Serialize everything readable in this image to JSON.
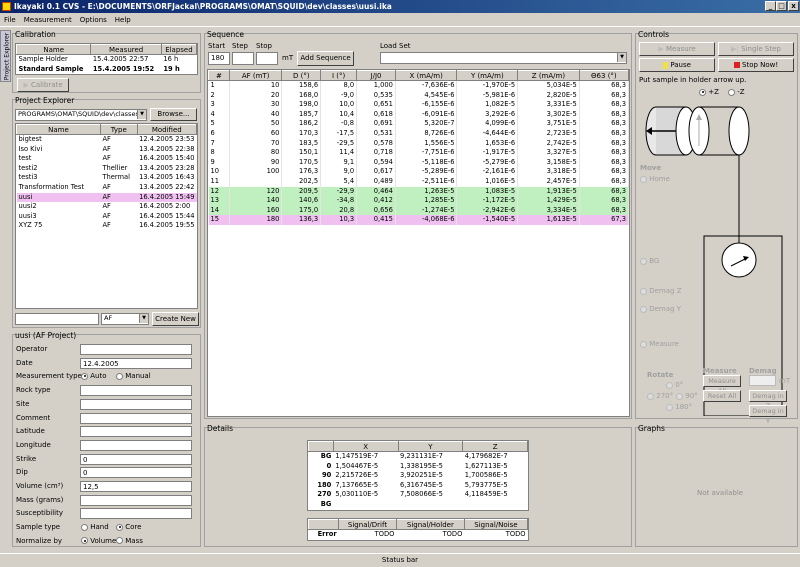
{
  "window": {
    "title": "Ikayaki 0.1 CVS - E:\\DOCUMENTS\\ORFJackal\\PROGRAMS\\OMAT\\SQUID\\dev\\classes\\uusi.ika",
    "min": "_",
    "max": "□",
    "close": "x"
  },
  "menu": [
    "File",
    "Measurement",
    "Options",
    "Help"
  ],
  "side_tab": "Project Explorer",
  "calibration": {
    "title": "Calibration",
    "headers": [
      "Name",
      "Measured",
      "Elapsed"
    ],
    "rows": [
      [
        "Sample Holder",
        "15.4.2005 22:57",
        "16 h"
      ],
      [
        "Standard Sample",
        "15.4.2005 19:52",
        "19 h"
      ]
    ],
    "button": "Calibrate"
  },
  "explorer": {
    "title": "Project Explorer",
    "path": "PROGRAMS\\OMAT\\SQUID\\dev\\classes",
    "browse": "Browse...",
    "headers": [
      "Name",
      "Type",
      "Modified"
    ],
    "rows": [
      [
        "bigtest",
        "AF",
        "12.4.2005 23:53"
      ],
      [
        "Iso Kivi",
        "AF",
        "13.4.2005 22:38"
      ],
      [
        "test",
        "AF",
        "16.4.2005 15:40"
      ],
      [
        "testi2",
        "Thellier",
        "13.4.2005 23:28"
      ],
      [
        "testi3",
        "Thermal",
        "13.4.2005 16:43"
      ],
      [
        "Transformation Test",
        "AF",
        "13.4.2005 22:42"
      ],
      [
        "uusi",
        "AF",
        "16.4.2005 15:49"
      ],
      [
        "uusi2",
        "AF",
        "16.4.2005 2:00"
      ],
      [
        "uusi3",
        "AF",
        "16.4.2005 15:44"
      ],
      [
        "XYZ 75",
        "AF",
        "16.4.2005 19:55"
      ]
    ],
    "new_type": "AF",
    "create": "Create New"
  },
  "info": {
    "title": "uusi (AF Project)",
    "fields": [
      [
        "Operator",
        ""
      ],
      [
        "Date",
        "12.4.2005"
      ],
      [
        "Measurement type",
        ""
      ],
      [
        "Rock type",
        ""
      ],
      [
        "Site",
        ""
      ],
      [
        "Comment",
        ""
      ],
      [
        "Latitude",
        ""
      ],
      [
        "Longitude",
        ""
      ],
      [
        "Strike",
        "0"
      ],
      [
        "Dip",
        "0"
      ],
      [
        "Volume (cm³)",
        "12,5"
      ],
      [
        "Mass (grams)",
        ""
      ],
      [
        "Susceptibility",
        ""
      ],
      [
        "Sample type",
        ""
      ],
      [
        "Normalize by",
        ""
      ]
    ],
    "mtype": [
      "Auto",
      "Manual"
    ],
    "stype": [
      "Hand",
      "Core"
    ],
    "norm": [
      "Volume",
      "Mass"
    ]
  },
  "sequence": {
    "title": "Sequence",
    "start_lbl": "Start",
    "step_lbl": "Step",
    "stop_lbl": "Stop",
    "start": "180",
    "unit": "mT",
    "add": "Add Sequence",
    "load_lbl": "Load Set",
    "headers": [
      "#",
      "AF (mT)",
      "D (°)",
      "I (°)",
      "J/J0",
      "X (mA/m)",
      "Y (mA/m)",
      "Z (mA/m)",
      "Θ63 (°)"
    ],
    "rows": [
      [
        "1",
        "10",
        "158,6",
        "8,0",
        "1,000",
        "-7,636E-6",
        "-1,970E-5",
        "5,034E-5",
        "68,3"
      ],
      [
        "2",
        "20",
        "168,0",
        "-9,0",
        "0,535",
        "4,545E-6",
        "-5,981E-6",
        "2,820E-5",
        "68,3"
      ],
      [
        "3",
        "30",
        "198,0",
        "10,0",
        "0,651",
        "-6,155E-6",
        "1,082E-5",
        "3,331E-5",
        "68,3"
      ],
      [
        "4",
        "40",
        "185,7",
        "10,4",
        "0,618",
        "-6,091E-6",
        "3,292E-6",
        "3,302E-5",
        "68,3"
      ],
      [
        "5",
        "50",
        "186,2",
        "-0,8",
        "0,691",
        "5,320E-7",
        "4,099E-6",
        "3,751E-5",
        "68,3"
      ],
      [
        "6",
        "60",
        "170,3",
        "-17,5",
        "0,531",
        "8,726E-6",
        "-4,644E-6",
        "2,723E-5",
        "68,3"
      ],
      [
        "7",
        "70",
        "183,5",
        "-29,5",
        "0,578",
        "1,556E-5",
        "1,653E-6",
        "2,742E-5",
        "68,3"
      ],
      [
        "8",
        "80",
        "150,1",
        "11,4",
        "0,718",
        "-7,751E-6",
        "-1,917E-5",
        "3,327E-5",
        "68,3"
      ],
      [
        "9",
        "90",
        "170,5",
        "9,1",
        "0,594",
        "-5,118E-6",
        "-5,279E-6",
        "3,158E-5",
        "68,3"
      ],
      [
        "10",
        "100",
        "176,3",
        "9,0",
        "0,617",
        "-5,289E-6",
        "-2,161E-6",
        "3,318E-5",
        "68,3"
      ],
      [
        "11",
        "",
        "202,5",
        "5,4",
        "0,489",
        "-2,511E-6",
        "1,016E-5",
        "2,457E-5",
        "68,3"
      ],
      [
        "12",
        "120",
        "209,5",
        "-29,9",
        "0,464",
        "1,263E-5",
        "1,083E-5",
        "1,913E-5",
        "68,3"
      ],
      [
        "13",
        "140",
        "140,6",
        "-34,8",
        "0,412",
        "1,285E-5",
        "-1,172E-5",
        "1,429E-5",
        "68,3"
      ],
      [
        "14",
        "160",
        "175,0",
        "20,8",
        "0,656",
        "-1,274E-5",
        "-2,942E-6",
        "3,334E-5",
        "68,3"
      ],
      [
        "15",
        "180",
        "136,3",
        "10,3",
        "0,415",
        "-4,068E-6",
        "-1,540E-5",
        "1,613E-5",
        "67,3"
      ]
    ]
  },
  "controls": {
    "title": "Controls",
    "measure": "Measure",
    "single": "Single Step",
    "pause": "Pause",
    "stop": "Stop Now!",
    "hint": "Put sample in holder arrow up.",
    "pz": "+Z",
    "mz": "-Z",
    "move": "Move",
    "home": "Home",
    "bg": "BG",
    "demagz": "Demag Z",
    "demagy": "Demag Y",
    "measure_pos": "Measure",
    "rotate": "Rotate",
    "r0": "0°",
    "r90": "90°",
    "r180": "180°",
    "r270": "270°",
    "measure_lbl": "Measure",
    "measure_all": "Measure All",
    "reset_all": "Reset All",
    "demag_lbl": "Demag",
    "demag_unit": "mT",
    "demag_z": "Demag in Z",
    "demag_y": "Demag in Y",
    "accent_yellow": "#f0e040",
    "accent_red": "#e02020"
  },
  "details": {
    "title": "Details",
    "headers": [
      "",
      "X",
      "Y",
      "Z"
    ],
    "rows": [
      [
        "BG",
        "1,147519E-7",
        "9,231131E-7",
        "4,179682E-7"
      ],
      [
        "0",
        "1,504467E-5",
        "1,338195E-5",
        "1,627113E-5"
      ],
      [
        "90",
        "2,215726E-5",
        "3,920251E-5",
        "1,700586E-5"
      ],
      [
        "180",
        "7,137665E-5",
        "6,316745E-5",
        "5,793775E-5"
      ],
      [
        "270",
        "5,030110E-5",
        "7,508066E-5",
        "4,118459E-5"
      ],
      [
        "BG",
        "",
        "",
        ""
      ]
    ],
    "err_headers": [
      "",
      "Signal/Drift",
      "Signal/Holder",
      "Signal/Noise"
    ],
    "err_row": [
      "Error",
      "TODO",
      "TODO",
      "TODO"
    ]
  },
  "graphs": {
    "title": "Graphs",
    "na": "Not available"
  },
  "status": "Status bar"
}
